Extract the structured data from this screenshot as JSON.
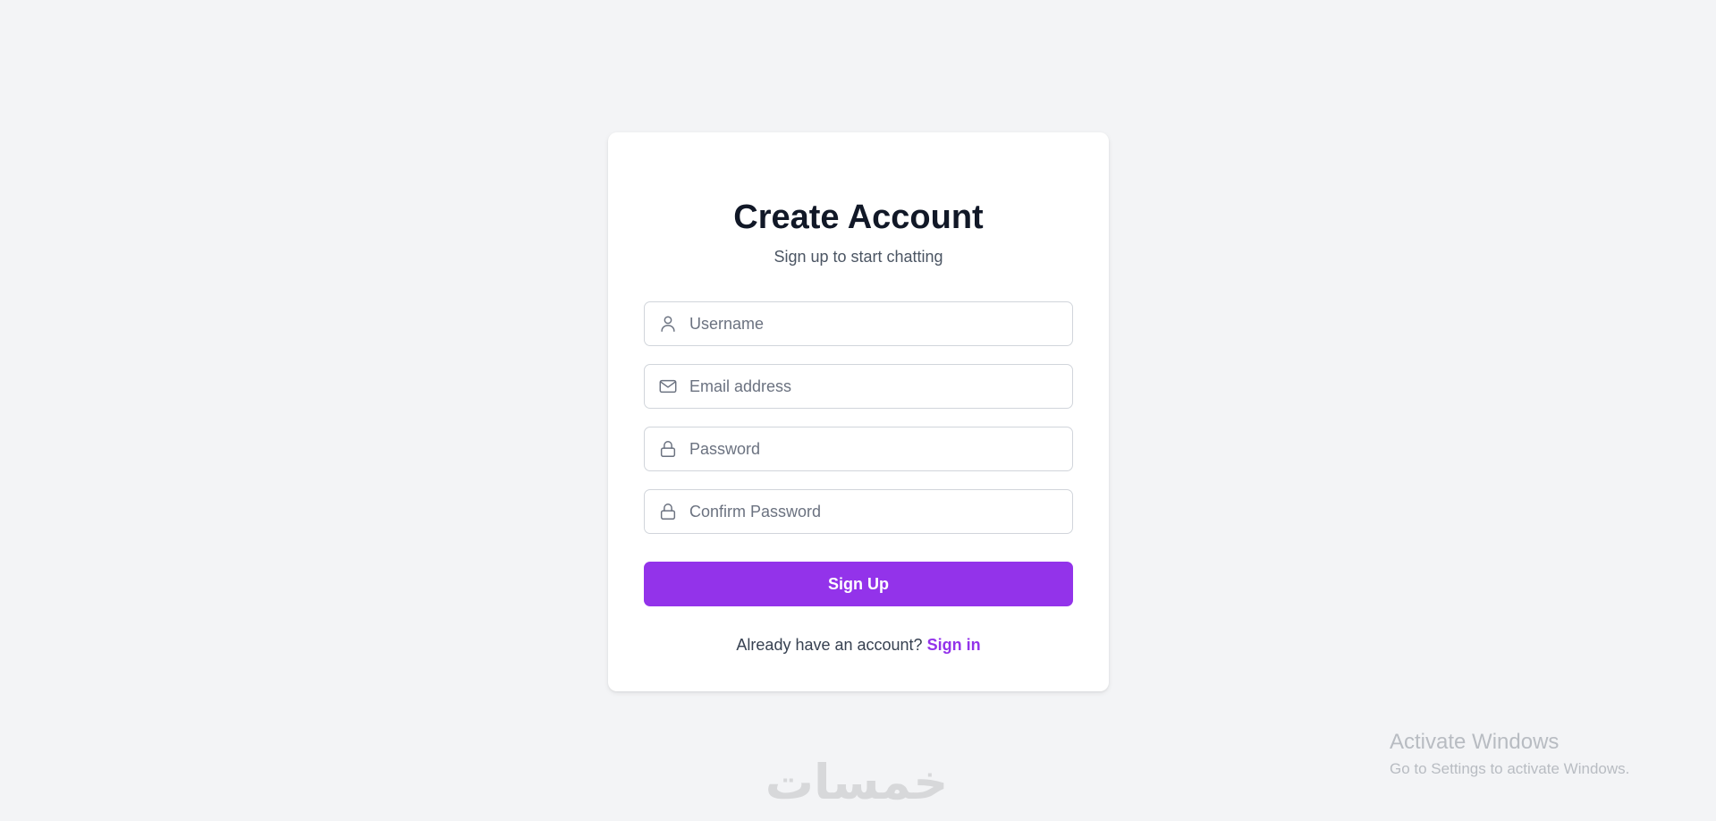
{
  "form": {
    "title": "Create Account",
    "subtitle": "Sign up to start chatting",
    "username_placeholder": "Username",
    "email_placeholder": "Email address",
    "password_placeholder": "Password",
    "confirm_password_placeholder": "Confirm Password",
    "submit_label": "Sign Up",
    "signin_prompt": "Already have an account? ",
    "signin_link": "Sign in"
  },
  "icons": {
    "username": "user-icon",
    "email": "mail-icon",
    "password": "lock-icon",
    "confirm_password": "lock-icon"
  },
  "colors": {
    "accent": "#9333ea",
    "background": "#f3f4f6",
    "card": "#ffffff"
  },
  "watermark": {
    "text": "خمسات"
  },
  "os_notice": {
    "title": "Activate Windows",
    "body": "Go to Settings to activate Windows."
  }
}
